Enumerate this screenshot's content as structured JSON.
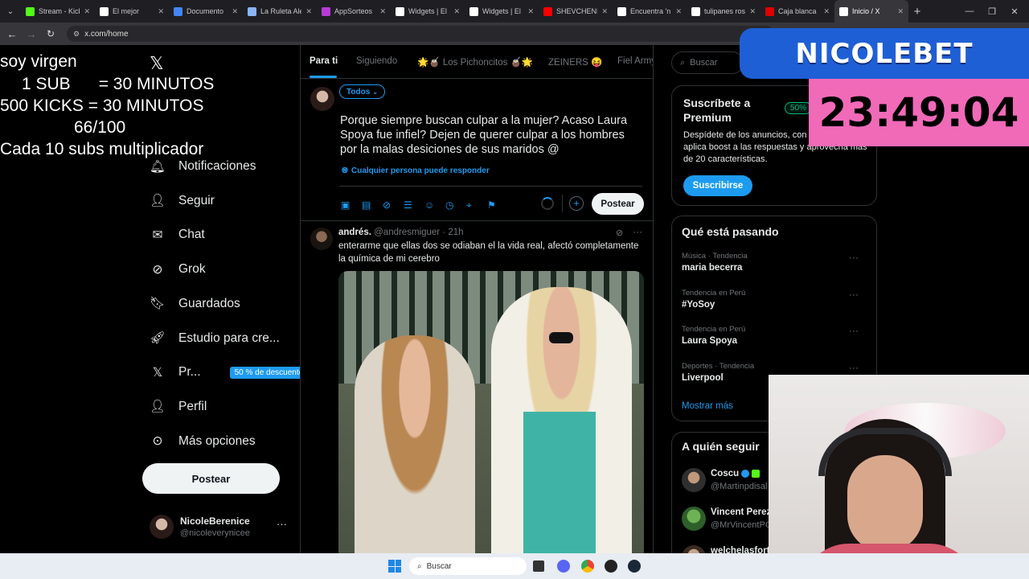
{
  "browser": {
    "tabs": [
      {
        "label": "Stream - Kick",
        "color": "#53fc18",
        "active": false
      },
      {
        "label": "El mejor",
        "color": "#ffffff",
        "active": false
      },
      {
        "label": "Documento",
        "color": "#4285f4",
        "active": false
      },
      {
        "label": "La Ruleta Ale",
        "color": "#8ab4f8",
        "active": false
      },
      {
        "label": "AppSorteos",
        "color": "#b73bd6",
        "active": false
      },
      {
        "label": "Widgets | El",
        "color": "#ffffff",
        "active": false
      },
      {
        "label": "Widgets | El",
        "color": "#ffffff",
        "active": false
      },
      {
        "label": "SHEVCHENK",
        "color": "#ff0000",
        "active": false
      },
      {
        "label": "Encuentra 'n",
        "color": "#ffffff",
        "active": false
      },
      {
        "label": "tulipanes ros",
        "color": "#ffffff",
        "active": false
      },
      {
        "label": "Caja blanca",
        "color": "#e00000",
        "active": false
      },
      {
        "label": "Inicio / X",
        "color": "#ffffff",
        "active": true
      }
    ],
    "url": "x.com/home"
  },
  "overlay": {
    "line1": "soy virgen",
    "line2": "1 SUB      = 30 MINUTOS",
    "line3": "500 KICKS = 30 MINUTOS",
    "line4": "66/100",
    "line5": "Cada 10 subs multiplicador",
    "brand": "NICOLEBET",
    "timer": "23:49:04"
  },
  "nav": {
    "items": [
      {
        "label": "Notificaciones",
        "icon": "bell-icon"
      },
      {
        "label": "Seguir",
        "icon": "add-user-icon"
      },
      {
        "label": "Chat",
        "icon": "mail-icon"
      },
      {
        "label": "Grok",
        "icon": "grok-icon"
      },
      {
        "label": "Guardados",
        "icon": "bookmark-icon"
      },
      {
        "label": "Estudio para cre...",
        "icon": "rocket-icon"
      },
      {
        "label": "Pr...",
        "icon": "x-logo-icon",
        "badge": "50 % de descuento"
      },
      {
        "label": "Perfil",
        "icon": "person-icon"
      },
      {
        "label": "Más opciones",
        "icon": "more-circle-icon"
      }
    ],
    "post_button": "Postear",
    "account": {
      "name": "NicoleBerenice",
      "handle": "@nicoleverynicee"
    }
  },
  "feed": {
    "tabs": [
      "Para ti",
      "Siguiendo",
      "🌟🧉 Los Pichoncitos 🧉🌟",
      "ZEINERS 😝",
      "Fiel Army"
    ],
    "composer": {
      "audience": "Todos",
      "text": "Porque siempre buscan culpar a la mujer? Acaso Laura Spoya fue infiel? Dejen de querer culpar a los hombres por la malas desiciones de sus maridos @",
      "reply_setting": "Cualquier persona puede responder",
      "submit": "Postear"
    },
    "post": {
      "author": "andrés.",
      "handle": "@andresmiguer",
      "time": "· 21h",
      "text": "enterarme que ellas dos se odiaban el la vida real, afectó completamente la química de mi cerebro"
    }
  },
  "right": {
    "search_placeholder": "Buscar",
    "premium": {
      "title": "Suscríbete a Premium",
      "badge": "50%",
      "body": "Despídete de los anuncios, con estadísticas, aplica boost a las respuestas y aprovecha más de 20 características.",
      "button": "Suscribirse"
    },
    "trending": {
      "title": "Qué está pasando",
      "items": [
        {
          "meta": "Música · Tendencia",
          "name": "maria becerra"
        },
        {
          "meta": "Tendencia en Perú",
          "name": "#YoSoy"
        },
        {
          "meta": "Tendencia en Perú",
          "name": "Laura Spoya"
        },
        {
          "meta": "Deportes · Tendencia",
          "name": "Liverpool"
        }
      ],
      "show_more": "Mostrar más"
    },
    "follow": {
      "title": "A quién seguir",
      "items": [
        {
          "name": "Coscu",
          "handle": "@Martinpdisal"
        },
        {
          "name": "Vincent Perez",
          "handle": "@MrVincentPC"
        },
        {
          "name": "welchelasfort",
          "handle": ""
        }
      ]
    }
  },
  "taskbar": {
    "search_placeholder": "Buscar"
  }
}
